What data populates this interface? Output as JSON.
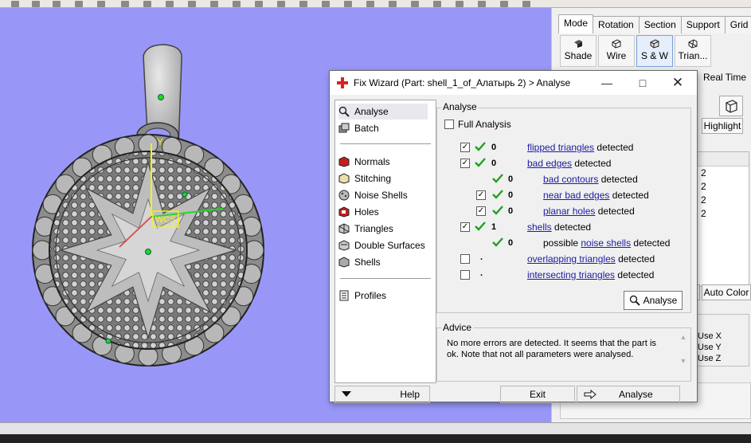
{
  "right_panel": {
    "tabs": [
      "Mode",
      "Rotation",
      "Section",
      "Support",
      "Grid"
    ],
    "mode_buttons": [
      "Shade",
      "Wire",
      "S & W",
      "Trian..."
    ],
    "realtime_label": "Real Time",
    "highlight_label": "Highlight",
    "list_values": [
      "2",
      "2",
      "2",
      "2"
    ],
    "auto_color_label": "Auto Color",
    "use_labels": [
      "Use X",
      "Use Y",
      "Use Z"
    ]
  },
  "dialog": {
    "title": "Fix Wizard (Part: shell_1_of_Алатырь 2) > Analyse",
    "nav": {
      "top": [
        "Analyse",
        "Batch"
      ],
      "middle": [
        "Normals",
        "Stitching",
        "Noise Shells",
        "Holes",
        "Triangles",
        "Double Surfaces",
        "Shells"
      ],
      "bottom": [
        "Profiles"
      ]
    },
    "analyse_group_label": "Analyse",
    "full_analysis_label": "Full Analysis",
    "rows": [
      {
        "count": "0",
        "link": "flipped triangles",
        "prefix": "",
        "suffix": " detected"
      },
      {
        "count": "0",
        "link": "bad edges",
        "prefix": "",
        "suffix": " detected"
      },
      {
        "count": "0",
        "link": "bad contours",
        "prefix": "",
        "suffix": " detected"
      },
      {
        "count": "0",
        "link": "near bad edges",
        "prefix": "",
        "suffix": " detected"
      },
      {
        "count": "0",
        "link": "planar holes",
        "prefix": "",
        "suffix": " detected"
      },
      {
        "count": "1",
        "link": "shells",
        "prefix": "",
        "suffix": " detected"
      },
      {
        "count": "0",
        "link": "noise shells",
        "prefix": "possible ",
        "suffix": " detected"
      },
      {
        "count": ".",
        "link": "overlapping triangles",
        "prefix": "",
        "suffix": " detected"
      },
      {
        "count": ".",
        "link": "intersecting triangles",
        "prefix": "",
        "suffix": " detected"
      }
    ],
    "analyse_button": "Analyse",
    "advice_label": "Advice",
    "advice_text": "No more errors are detected. It seems that the part is ok. Note that not all parameters were analysed.",
    "help_label": "Help",
    "exit_label": "Exit",
    "analyse_bottom_label": "Analyse"
  },
  "viewport": {
    "axis_label": "WCS",
    "y_axis_label": "Y"
  }
}
